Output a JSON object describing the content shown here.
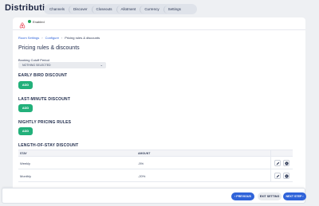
{
  "app": {
    "title": "Distribution"
  },
  "nav": {
    "tabs": [
      {
        "label": "Channels"
      },
      {
        "label": "Discover"
      },
      {
        "label": "Closeouts"
      },
      {
        "label": "Allotment"
      },
      {
        "label": "Currency"
      },
      {
        "label": "Settings"
      }
    ]
  },
  "channel": {
    "logo_icon": "airbnb-logo-icon",
    "status": "Enabled",
    "status_color": "#22a35a"
  },
  "breadcrumb": {
    "items": [
      "Room Settings",
      "Configure"
    ],
    "current": "Pricing rules & discounts",
    "separator": "›"
  },
  "page": {
    "title": "Pricing rules & discounts"
  },
  "booking_cutoff": {
    "label": "Booking Cutoff Period",
    "value": "NOTHING SELECTED"
  },
  "sections": {
    "early_bird": {
      "title": "EARLY BIRD DISCOUNT",
      "button": "ADD"
    },
    "last_minute": {
      "title": "LAST-MINUTE DISCOUNT",
      "button": "ADD"
    },
    "nightly": {
      "title": "NIGHTLY PRICING RULES",
      "button": "ADD"
    },
    "length_of_stay": {
      "title": "LENGTH-OF-STAY DISCOUNT",
      "columns": [
        "STAY",
        "AMOUNT"
      ],
      "rows": [
        {
          "stay": "Weekly",
          "amount": "-5%"
        },
        {
          "stay": "Monthly",
          "amount": "-20%"
        }
      ]
    }
  },
  "footer": {
    "previous": "‹ PREVIOUS",
    "exit": "EXIT SETTING",
    "next": "NEXT STEP ›"
  },
  "colors": {
    "accent": "#2f63d9",
    "add_button": "#22b07a"
  }
}
